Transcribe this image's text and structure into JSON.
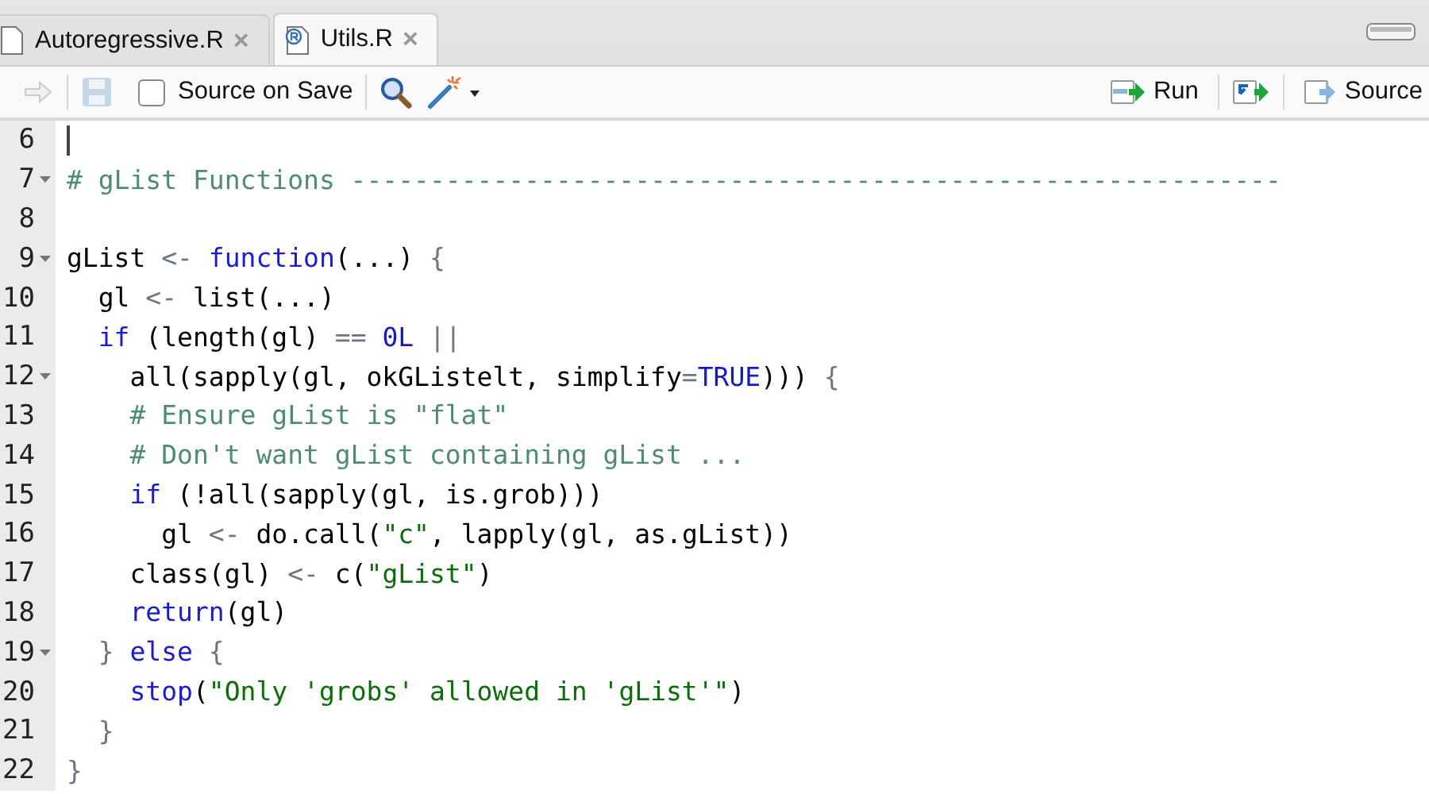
{
  "tabs": [
    {
      "label": "Autoregressive.R",
      "selected": false,
      "close": "×"
    },
    {
      "label": "Utils.R",
      "selected": true,
      "close": "×"
    }
  ],
  "toolbar": {
    "source_on_save": {
      "label": "Source on Save",
      "checked": false
    },
    "run": "Run",
    "source": "Source"
  },
  "editor": {
    "lines": [
      {
        "number": "6",
        "fold": false,
        "cursor": true
      },
      {
        "number": "7",
        "fold": true,
        "cursor": false,
        "tokens": [
          {
            "kind": "comment",
            "text": "# gList Functions -----------------------------------------------------------"
          }
        ]
      },
      {
        "number": "8",
        "fold": false,
        "cursor": false
      },
      {
        "number": "9",
        "fold": true,
        "cursor": false,
        "tokens": [
          {
            "kind": "plain",
            "text": "gList "
          },
          {
            "kind": "op",
            "text": "<- "
          },
          {
            "kind": "keyword",
            "text": "function"
          },
          {
            "kind": "plain",
            "text": "(...) "
          },
          {
            "kind": "op",
            "text": "{"
          }
        ]
      },
      {
        "number": "10",
        "fold": false,
        "cursor": false,
        "tokens": [
          {
            "kind": "plain",
            "text": "  gl "
          },
          {
            "kind": "op",
            "text": "<-"
          },
          {
            "kind": "plain",
            "text": " list(...)"
          }
        ]
      },
      {
        "number": "11",
        "fold": false,
        "cursor": false,
        "tokens": [
          {
            "kind": "keyword",
            "text": "  if"
          },
          {
            "kind": "plain",
            "text": " (length(gl) "
          },
          {
            "kind": "op",
            "text": "== "
          },
          {
            "kind": "number",
            "text": "0L"
          },
          {
            "kind": "op",
            "text": " ||"
          }
        ]
      },
      {
        "number": "12",
        "fold": true,
        "cursor": false,
        "tokens": [
          {
            "kind": "plain",
            "text": "    all(sapply(gl, okGListelt, simplify"
          },
          {
            "kind": "op",
            "text": "="
          },
          {
            "kind": "number",
            "text": "TRUE"
          },
          {
            "kind": "plain",
            "text": "))) "
          },
          {
            "kind": "op",
            "text": "{"
          }
        ]
      },
      {
        "number": "13",
        "fold": false,
        "cursor": false,
        "tokens": [
          {
            "kind": "comment",
            "text": "    # Ensure gList is \"flat\""
          }
        ]
      },
      {
        "number": "14",
        "fold": false,
        "cursor": false,
        "tokens": [
          {
            "kind": "comment",
            "text": "    # Don't want gList containing gList ..."
          }
        ]
      },
      {
        "number": "15",
        "fold": false,
        "cursor": false,
        "tokens": [
          {
            "kind": "keyword",
            "text": "    if"
          },
          {
            "kind": "plain",
            "text": " (!all(sapply(gl, is.grob)))"
          }
        ]
      },
      {
        "number": "16",
        "fold": false,
        "cursor": false,
        "tokens": [
          {
            "kind": "plain",
            "text": "      gl "
          },
          {
            "kind": "op",
            "text": "<-"
          },
          {
            "kind": "plain",
            "text": " do.call("
          },
          {
            "kind": "string",
            "text": "\"c\""
          },
          {
            "kind": "plain",
            "text": ", lapply(gl, as.gList))"
          }
        ]
      },
      {
        "number": "17",
        "fold": false,
        "cursor": false,
        "tokens": [
          {
            "kind": "plain",
            "text": "    class(gl) "
          },
          {
            "kind": "op",
            "text": "<-"
          },
          {
            "kind": "plain",
            "text": " c("
          },
          {
            "kind": "string",
            "text": "\"gList\""
          },
          {
            "kind": "plain",
            "text": ")"
          }
        ]
      },
      {
        "number": "18",
        "fold": false,
        "cursor": false,
        "tokens": [
          {
            "kind": "keyword",
            "text": "    return"
          },
          {
            "kind": "plain",
            "text": "(gl)"
          }
        ]
      },
      {
        "number": "19",
        "fold": true,
        "cursor": false,
        "tokens": [
          {
            "kind": "op",
            "text": "  }"
          },
          {
            "kind": "keyword",
            "text": " else"
          },
          {
            "kind": "op",
            "text": " {"
          }
        ]
      },
      {
        "number": "20",
        "fold": false,
        "cursor": false,
        "tokens": [
          {
            "kind": "keyword",
            "text": "    stop"
          },
          {
            "kind": "plain",
            "text": "("
          },
          {
            "kind": "string",
            "text": "\"Only 'grobs' allowed in 'gList'\""
          },
          {
            "kind": "plain",
            "text": ")"
          }
        ]
      },
      {
        "number": "21",
        "fold": false,
        "cursor": false,
        "tokens": [
          {
            "kind": "op",
            "text": "  }"
          }
        ]
      },
      {
        "number": "22",
        "fold": false,
        "cursor": false,
        "tokens": [
          {
            "kind": "op",
            "text": "}"
          }
        ]
      }
    ]
  }
}
